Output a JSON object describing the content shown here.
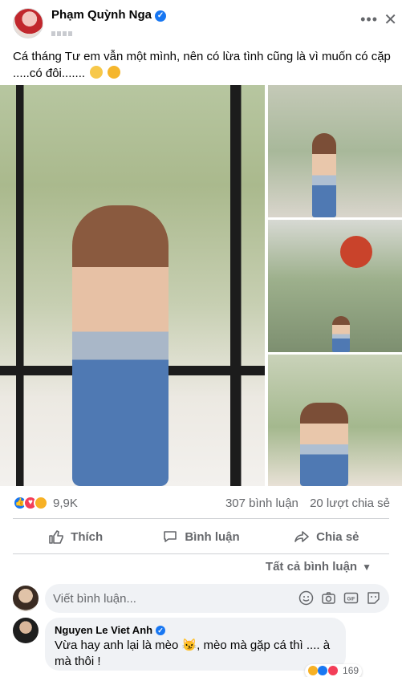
{
  "post": {
    "author": "Phạm Quỳnh Nga",
    "verified_mark": "✓",
    "more_label": "•••",
    "close_label": "✕",
    "text": "Cá tháng Tư em vẫn một mình, nên có lừa tình cũng là vì muốn có cặp .....có đôi.......",
    "text_emoji": [
      "smiling-face-with-hearts",
      "star-struck"
    ]
  },
  "gallery": {
    "photos": [
      {
        "icon": "photo-main"
      },
      {
        "icon": "photo-top-right"
      },
      {
        "icon": "photo-middle-right"
      },
      {
        "icon": "photo-bottom-right"
      }
    ]
  },
  "engagement": {
    "reaction_icons": [
      "like-icon",
      "love-icon",
      "care-icon"
    ],
    "reaction_count": "9,9K",
    "comments": "307 bình luận",
    "shares": "20 lượt chia sẻ"
  },
  "actions": {
    "like": "Thích",
    "comment": "Bình luận",
    "share": "Chia sẻ"
  },
  "comments_filter": {
    "label": "Tất cả bình luận",
    "caret": "▼"
  },
  "composer": {
    "placeholder": "Viết bình luận...",
    "icons": [
      "emoji-icon",
      "camera-icon",
      "gif-icon",
      "sticker-icon"
    ]
  },
  "comment": {
    "author": "Nguyen Le Viet Anh",
    "text": "Vừa hay anh lại là mèo 😼, mèo mà gặp cá thì .... à mà thôi !",
    "reaction_count": "169"
  },
  "colors": {
    "brand": "#1877f2",
    "love": "#f33e58",
    "care": "#f7b125",
    "muted_text": "#65676b",
    "bubble": "#f0f2f5"
  }
}
